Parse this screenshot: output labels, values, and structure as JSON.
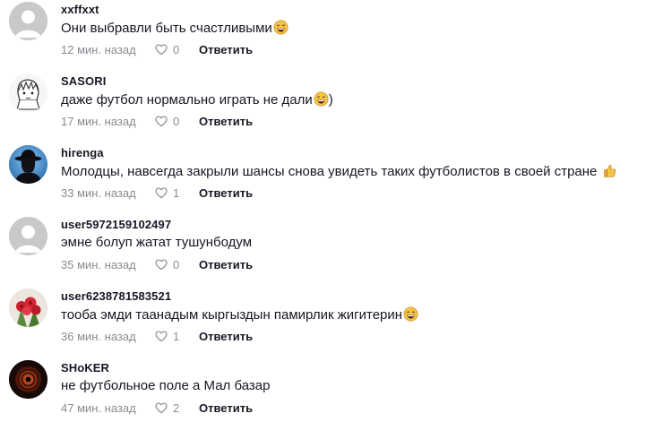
{
  "comments": [
    {
      "username": "xxffxxt",
      "text": "Они выбравли быть счастливыми",
      "emoji": "laughing-emoji",
      "time": "12 мин. назад",
      "likes": "0",
      "reply": "Ответить"
    },
    {
      "username": "SASORI",
      "text": "даже футбол нормально играть не дали",
      "emoji": "laughing-emoji",
      "text_after": ")",
      "time": "17 мин. назад",
      "likes": "0",
      "reply": "Ответить"
    },
    {
      "username": "hirenga",
      "text": "Молодцы, навсегда закрыли шансы снова увидеть таких футболистов в своей стране ",
      "emoji": "thumbs-up-emoji",
      "time": "33 мин. назад",
      "likes": "1",
      "reply": "Ответить"
    },
    {
      "username": "user5972159102497",
      "text": "эмне болуп жатат тушунбодум",
      "time": "35 мин. назад",
      "likes": "0",
      "reply": "Ответить"
    },
    {
      "username": "user6238781583521",
      "text": "тооба эмди таанадым кыргыздын памирлик жигитерин",
      "emoji": "laughing-emoji",
      "time": "36 мин. назад",
      "likes": "1",
      "reply": "Ответить"
    },
    {
      "username": "SHoKER",
      "text": "не футбольное поле а Мал базар",
      "time": "47 мин. назад",
      "likes": "2",
      "reply": "Ответить"
    }
  ],
  "colors": {
    "text": "#161823",
    "muted": "#8a8b91",
    "default_avatar": "#c9c9cc"
  }
}
